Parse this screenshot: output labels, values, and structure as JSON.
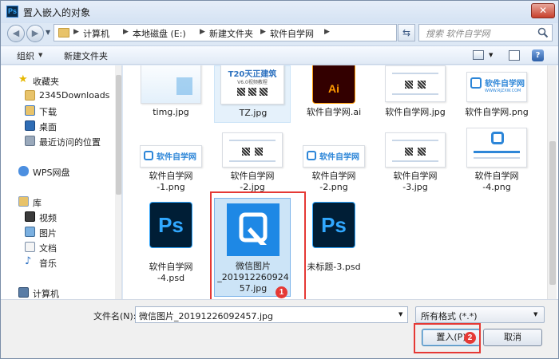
{
  "window": {
    "title": "置入嵌入的对象",
    "app_icon": "Ps",
    "close_glyph": "✕"
  },
  "address": {
    "crumbs": [
      "计算机",
      "本地磁盘 (E:)",
      "新建文件夹",
      "软件自学网"
    ],
    "search_placeholder": "搜索 软件自学网"
  },
  "toolbar": {
    "organize": "组织",
    "new_folder": "新建文件夹",
    "help": "?"
  },
  "nav": {
    "items": [
      {
        "label": "收藏夹",
        "icon": "star-icon"
      },
      {
        "label": "2345Downloads",
        "icon": "folder-icon"
      },
      {
        "label": "下载",
        "icon": "download-folder-icon"
      },
      {
        "label": "桌面",
        "icon": "desktop-icon"
      },
      {
        "label": "最近访问的位置",
        "icon": "recent-places-icon"
      },
      {
        "label": "WPS网盘",
        "icon": "cloud-icon"
      },
      {
        "label": "库",
        "icon": "library-icon"
      },
      {
        "label": "视频",
        "icon": "video-icon"
      },
      {
        "label": "图片",
        "icon": "picture-icon"
      },
      {
        "label": "文档",
        "icon": "document-icon"
      },
      {
        "label": "音乐",
        "icon": "music-icon"
      },
      {
        "label": "计算机",
        "icon": "computer-icon"
      }
    ]
  },
  "files": {
    "row1": [
      {
        "name": "timg.jpg"
      },
      {
        "name": "TZ.jpg",
        "thumb_title": "T20天正建筑",
        "thumb_sub": "V6.0视频教程"
      },
      {
        "name": "软件自学网.ai",
        "thumb_label": "Ai"
      },
      {
        "name": "软件自学网.jpg"
      },
      {
        "name": "软件自学网.png",
        "thumb_brand": "软件自学网",
        "thumb_url": "WWW.RJZXW.COM"
      }
    ],
    "row2": [
      {
        "name": "软件自学网\n-1.png",
        "thumb_brand": "软件自学网"
      },
      {
        "name": "软件自学网\n-2.jpg"
      },
      {
        "name": "软件自学网\n-2.png",
        "thumb_brand": "软件自学网"
      },
      {
        "name": "软件自学网\n-3.jpg"
      },
      {
        "name": "软件自学网\n-4.png"
      }
    ],
    "row3": [
      {
        "name": "软件自学网\n-4.psd",
        "thumb_label": "Ps"
      },
      {
        "name": "微信图片\n_201912260924\n57.jpg"
      },
      {
        "name": "未标题-3.psd",
        "thumb_label": "Ps"
      }
    ]
  },
  "annotations": {
    "badge1": "1",
    "badge2": "2"
  },
  "bottom": {
    "filename_label": "文件名(N):",
    "filename_value": "微信图片_20191226092457.jpg",
    "filter_value": "所有格式 (*.*)",
    "insert_label": "置入(P)",
    "cancel_label": "取消"
  },
  "colors": {
    "accent": "#1e88e5",
    "annotation_red": "#e53935"
  }
}
